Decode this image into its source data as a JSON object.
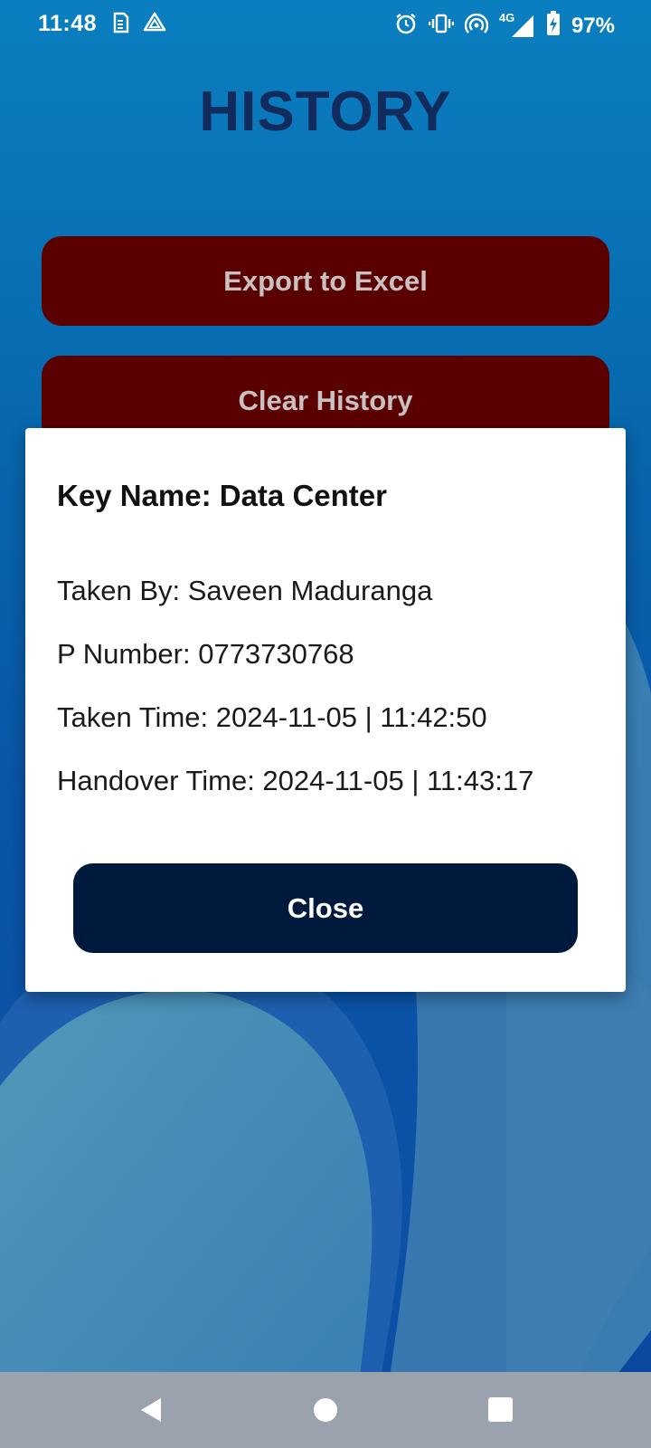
{
  "status_bar": {
    "time": "11:48",
    "network": "4G",
    "battery": "97%",
    "icons": [
      "sim-card-icon",
      "drive-icon",
      "alarm-icon",
      "vibrate-icon",
      "hotspot-icon",
      "signal-icon",
      "battery-charging-icon"
    ]
  },
  "page": {
    "title": "HISTORY",
    "export_label": "Export to Excel",
    "clear_label": "Clear History"
  },
  "dialog": {
    "title": "Key Name: Data Center",
    "taken_by": "Taken By: Saveen Maduranga",
    "phone": "P Number: 0773730768",
    "taken_time": "Taken Time: 2024-11-05 | 11:42:50",
    "handover_time": "Handover Time: 2024-11-05 | 11:43:17",
    "close_label": "Close"
  },
  "nav_bar": {
    "icons": [
      "back-icon",
      "home-icon",
      "recents-icon"
    ]
  },
  "colors": {
    "action_button": "#5a0000",
    "close_button": "#001a3d",
    "title": "#102b5c"
  }
}
